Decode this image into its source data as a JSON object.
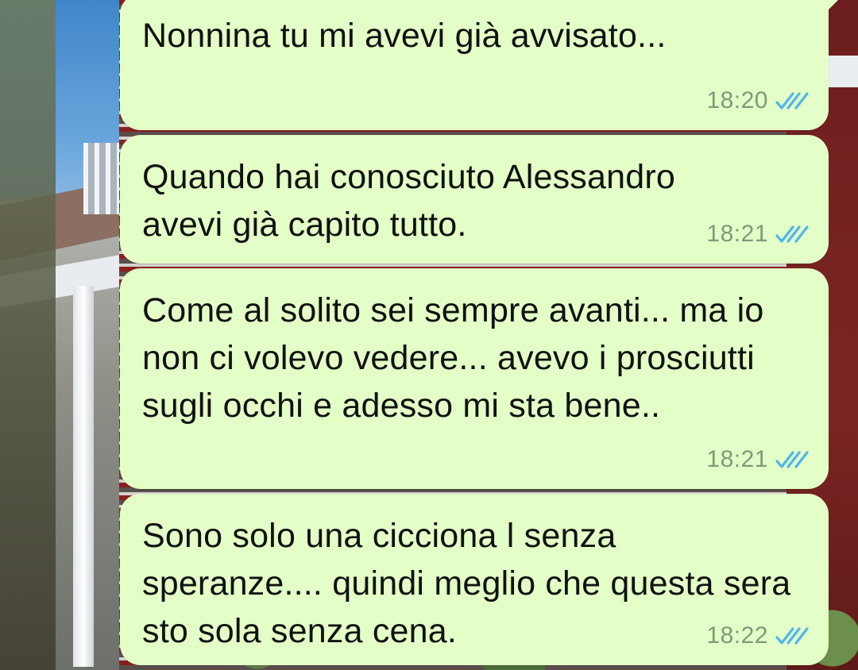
{
  "conversation": {
    "messages": [
      {
        "text": "Nonnina tu mi avevi già avvisato...",
        "time": "18:20",
        "status_icon": "double-check-read-icon"
      },
      {
        "text": "Quando hai conosciuto Alessandro avevi già capito tutto.",
        "time": "18:21",
        "status_icon": "double-check-read-icon"
      },
      {
        "text": "Come al solito sei sempre avanti... ma io non ci volevo vedere... avevo i prosciutti sugli occhi e adesso mi sta bene..",
        "time": "18:21",
        "status_icon": "double-check-read-icon"
      },
      {
        "text": "Sono solo una cicciona l senza speranze.... quindi meglio che questa sera sto sola senza cena.",
        "time": "18:22",
        "status_icon": "double-check-read-icon"
      }
    ]
  },
  "colors": {
    "bubble_outgoing": "#e3fec7",
    "timestamp": "#7f9a79",
    "read_ticks": "#4fb6ec"
  }
}
